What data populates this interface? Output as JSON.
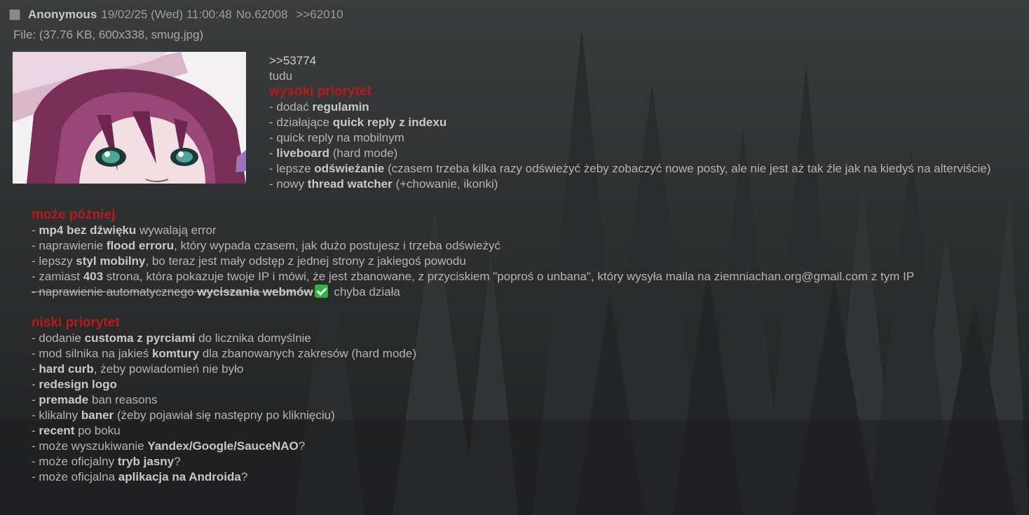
{
  "post": {
    "name": "Anonymous",
    "date": "19/02/25 (Wed) 11:00:48",
    "number": "No.62008",
    "backlink": ">>62010",
    "file_info": "File: (37.76 KB, 600x338, smug.jpg)"
  },
  "body": {
    "quote": ">>53774",
    "intro": "tudu",
    "high": {
      "title": "wysoki priorytet",
      "l1": {
        "a": "- dodać ",
        "b": "regulamin"
      },
      "l2": {
        "a": "- działające ",
        "b": "quick reply z indexu"
      },
      "l3": {
        "a": "- quick reply na mobilnym"
      },
      "l4": {
        "a": "- ",
        "b": "liveboard",
        "c": " (hard mode)"
      },
      "l5": {
        "a": "- lepsze ",
        "b": "odświeżanie",
        "c": " (czasem trzeba kilka razy odświeżyć żeby zobaczyć nowe posty, ale nie jest aż tak źle jak na kiedyś na alterviście)"
      },
      "l6": {
        "a": "- nowy ",
        "b": "thread watcher",
        "c": " (+chowanie, ikonki)"
      }
    },
    "later": {
      "title": "może później",
      "l1": {
        "a": "- ",
        "b": "mp4 bez dźwięku",
        "c": " wywalają error"
      },
      "l2": {
        "a": "- naprawienie ",
        "b": "flood erroru",
        "c": ", który wypada czasem, jak dużo postujesz i trzeba odświeżyć"
      },
      "l3": {
        "a": "- lepszy ",
        "b": "styl mobilny",
        "c": ", bo teraz jest mały odstęp z jednej strony z jakiegoś powodu"
      },
      "l4": {
        "a": "- zamiast ",
        "b": "403",
        "c": " strona, która pokazuje twoje IP i mówi, że jest zbanowane, z przyciskiem \"poproś o unbana\", który wysyła maila na ziemniachan.org@gmail.com z tym IP"
      },
      "l5": {
        "a": "- naprawienie automatycznego ",
        "b": "wyciszania webmów",
        "c": " chyba działa"
      }
    },
    "low": {
      "title": "niski priorytet",
      "l1": {
        "a": "- dodanie ",
        "b": "customa z pyrciami",
        "c": " do licznika domyślnie"
      },
      "l2": {
        "a": "- mod silnika na jakieś ",
        "b": "komtury",
        "c": " dla zbanowanych zakresów (hard mode)"
      },
      "l3": {
        "a": "- ",
        "b": "hard curb",
        "c": ", żeby powiadomień nie było"
      },
      "l4": {
        "a": "- ",
        "b": "redesign logo"
      },
      "l5": {
        "a": "- ",
        "b": "premade",
        "c": " ban reasons"
      },
      "l6": {
        "a": "- klikalny ",
        "b": "baner",
        "c": " (żeby pojawiał się następny po kliknięciu)"
      },
      "l7": {
        "a": "- ",
        "b": "recent",
        "c": " po boku"
      },
      "l8": {
        "a": "- może wyszukiwanie ",
        "b": "Yandex/Google/SauceNAO",
        "c": "?"
      },
      "l9": {
        "a": "- może oficjalny ",
        "b": "tryb jasny",
        "c": "?"
      },
      "l10": {
        "a": "- może oficjalna ",
        "b": "aplikacja na Androida",
        "c": "?"
      }
    }
  },
  "colors": {
    "heading_red": "#b51b1b",
    "text": "#b4b4b4",
    "bold_text": "#c8c8c8",
    "background": "#2b2d2e",
    "check_green": "#2fb340"
  },
  "icons": {
    "checkmark": "white-heavy-check-mark-icon",
    "select": "checkbox-icon"
  }
}
